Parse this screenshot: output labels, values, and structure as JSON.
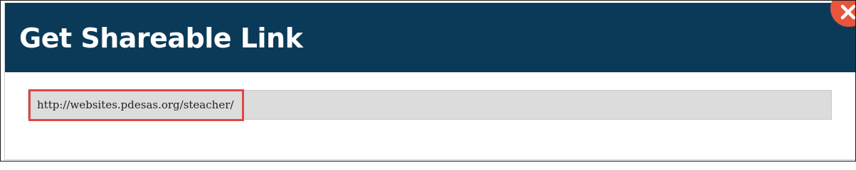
{
  "dialog": {
    "title": "Get Shareable Link",
    "close_icon": "close-icon",
    "link_value": "http://websites.pdesas.org/steacher/"
  },
  "colors": {
    "header_background": "#0b3a58",
    "close_button": "#e8553c",
    "field_background": "#dcdcdc",
    "highlight_border": "#e04646"
  }
}
